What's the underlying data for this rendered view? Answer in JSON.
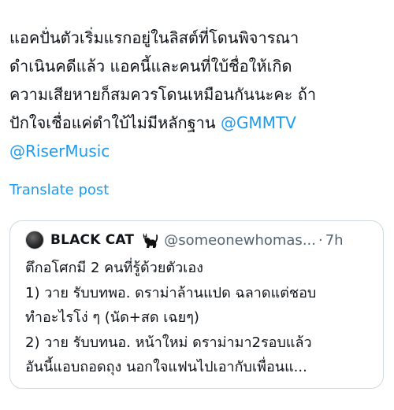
{
  "post": {
    "text_lines": [
      "แอคปั่นตัวเริ่มแรกอยู่ในลิสต์ที่โดนพิจารณา",
      "ดำเนินคดีแล้ว แอคนี้และคนที่ใบ้ชื่อให้เกิด",
      "ความเสียหายก็สมควรโดนเหมือนกันนะคะ ถ้า",
      "ปักใจเชื่อแค่ตำใบ้ไม่มีหลักฐาน "
    ],
    "mention_1": "@GMMTV",
    "mention_2": "@RiserMusic"
  },
  "translate_label": "Translate post",
  "quote": {
    "display_name": "BLACK CAT",
    "name_emoji": "black-cat-emoji",
    "handle": "@someonewhomas...",
    "separator": "·",
    "time": "7h",
    "lines": [
      "ตึกอโศกมี 2 คนที่รู้ด้วยตัวเอง",
      "1) วาย รับบทพอ. ดราม่าล้านแปด ฉลาดแต่ชอบ",
      "ทำอะไรโง่ ๆ (นัด+สด เฉยๆ)",
      "2) วาย รับบทนอ. หน้าใหม่ ดราม่ามา2รอบแล้ว",
      "อันนี้แอบถอดถุง นอกใจแฟนไปเอากับเพื่อนแ..."
    ]
  },
  "colors": {
    "link": "#1d9bf0",
    "text": "#0f1419",
    "secondary": "#536471",
    "border": "#cfd9de"
  }
}
